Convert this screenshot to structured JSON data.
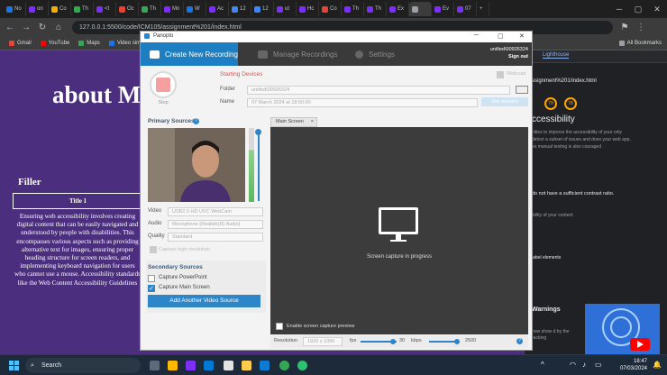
{
  "browser": {
    "tabs": [
      "No",
      "on",
      "Co",
      "Th",
      "<t",
      "Oc",
      "Th",
      "Mn",
      "W",
      "Ac",
      "12",
      "12",
      "ut",
      "Hc",
      "Co",
      "Th",
      "Th",
      "Ex",
      "",
      "Ev",
      "07"
    ],
    "url": "127.0.0.1:5500/code/ICM105/assignment%201/index.html",
    "bookmarks": [
      "Gmail",
      "YouTube",
      "Maps",
      "Video simpl"
    ],
    "all_bookmarks": "All Bookmarks",
    "colors": {
      "tab_favicons": [
        "#1a73e8",
        "#7b2ff7",
        "#f9ab00",
        "#34a853",
        "#7b2ff7",
        "#ea4335",
        "#34a853",
        "#7b2ff7",
        "#1a73e8",
        "#7b2ff7",
        "#4285f4",
        "#4285f4",
        "#7b2ff7",
        "#7b2ff7",
        "#ea4335",
        "#7b2ff7",
        "#7b2ff7",
        "#7b2ff7",
        "#9aa0a6",
        "#7b2ff7",
        "#7b2ff7"
      ]
    }
  },
  "page": {
    "heading": "about M",
    "filler": "Filler",
    "table_title": "Title 1",
    "paragraph": "Ensuring web accessibility involves creating digital content that can be easily navigated and understood by people with disabilities. This encompasses various aspects such as providing alternative text for images, ensuring proper heading structure for screen readers, and implementing keyboard navigation for users who cannot use a mouse. Accessibility standards like the Web Content Accessibility Guidelines"
  },
  "devtools": {
    "tab": "Lighthouse",
    "url": "ssignment%201/index.html",
    "scores": [
      "79",
      "78"
    ],
    "heading": "ccessibility",
    "description": "nities to improve the accessibility of your only detect a subset of issues and does your web app, so manual testing is also couraged",
    "contrast_item": "do not have a sufficient contrast ratio.",
    "name_item": "ibility of your content",
    "label_item": "label elements",
    "warnings": "Warnings",
    "warnings_text": "now show d by the racking"
  },
  "panopto": {
    "app_name": "Panopto",
    "user": "unified\\00926324",
    "sign_out": "Sign out",
    "tabs": [
      "Create New Recording",
      "Manage Recordings",
      "Settings"
    ],
    "starting_devices": "Starting Devices",
    "webcast": "Webcast",
    "stop_label": "Stop",
    "folder_label": "Folder",
    "folder_value": "unified\\00926324",
    "name_label": "Name",
    "name_value": "07 March 2024 at 18:50:00",
    "join_button": "Join session",
    "primary_sources": "Primary Sources",
    "video_label": "Video",
    "video_value": "USB2.0 HD UVC WebCam",
    "audio_label": "Audio",
    "audio_value": "Microphone (Realtek(R) Audio)",
    "quality_label": "Quality",
    "quality_value": "Standard",
    "high_res_capture": "Capture high resolution",
    "secondary_sources": "Secondary Sources",
    "capture_powerpoint": "Capture PowerPoint",
    "capture_main_screen": "Capture Main Screen",
    "add_video_source": "Add Another Video Source",
    "screen_tab": "Main Screen",
    "screen_capture_status": "Screen capture in progress",
    "enable_preview": "Enable screen capture preview",
    "resolution_label": "Resolution",
    "resolution_value": "1920 x 1080",
    "fps_label": "fps",
    "fps_value": "30",
    "kbps_label": "kbps",
    "kbps_value": "2500",
    "capture_powerpoint_checked": false,
    "capture_main_screen_checked": true,
    "colors": {
      "accent": "#1d7fc1",
      "record": "#f4a0a0",
      "warning": "#d9534f"
    }
  },
  "taskbar": {
    "search_placeholder": "Search",
    "time": "18:47",
    "date": "07/03/2024"
  }
}
